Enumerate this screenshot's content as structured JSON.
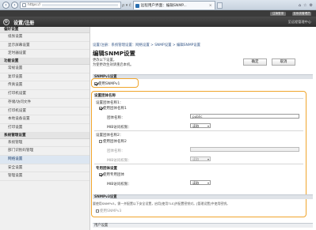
{
  "browser": {
    "url": "https://",
    "address_controls": "ρ ▾ ĉ",
    "tab_title": "远程用户界面：编辑SNMP...",
    "tab_close": "×",
    "win_controls": [
      "⌂",
      "☆",
      "⚙"
    ]
  },
  "header": {
    "top_button": "注销登录",
    "top_link": "至系统管理员",
    "title": "设置/注册",
    "right_link": "至远程管理中心"
  },
  "sidebar": {
    "items": [
      {
        "label": "偏好设置",
        "type": "head"
      },
      {
        "label": "纸张设置",
        "type": "item"
      },
      {
        "label": "显示屏幕设置",
        "type": "item"
      },
      {
        "label": "定时器设置",
        "type": "item"
      },
      {
        "label": "功能设置",
        "type": "head"
      },
      {
        "label": "常规设置",
        "type": "item"
      },
      {
        "label": "复印设置",
        "type": "item"
      },
      {
        "label": "传真设置",
        "type": "item"
      },
      {
        "label": "打印机设置",
        "type": "item"
      },
      {
        "label": "存储/访问文件",
        "type": "item"
      },
      {
        "label": "打印机设置",
        "type": "item"
      },
      {
        "label": "本地设备设置",
        "type": "item"
      },
      {
        "label": "打印设置",
        "type": "item"
      },
      {
        "label": "系统管理设置",
        "type": "head"
      },
      {
        "label": "系统管理",
        "type": "item"
      },
      {
        "label": "部门识别码管理",
        "type": "item"
      },
      {
        "label": "网络设置",
        "type": "item",
        "active": true
      },
      {
        "label": "安全设置",
        "type": "item"
      },
      {
        "label": "管理设置",
        "type": "item"
      }
    ]
  },
  "main": {
    "breadcrumb": "设置/注册：系统管理设置：网络设置 > SNMP设置 > 编辑SNMP设置",
    "title": "编辑SNMP设置",
    "note1": "更改以下设置。",
    "note2": "为使更改生效请重启本机。",
    "ok": "确定",
    "cancel": "取消",
    "snmpv1_header": "SNMPv1设置",
    "use_snmpv1": "使用SNMPv1",
    "community_header": "设置团体名称",
    "c1_title": "设置团体名称1：",
    "c1_use": "使用团体名称1",
    "c1_name_label": "团体名称：",
    "c1_name_value": "public",
    "c1_mib_label": "MIB访问权限：",
    "c1_mib_value": "读取",
    "c2_title": "设置团体名称2：",
    "c2_use": "使用团体名称2",
    "c2_name_label": "团体名称：",
    "c2_name_value": "",
    "c2_mib_label": "MIB访问权限：",
    "c2_mib_value": "读取",
    "dedicated_header": "专用团体设置",
    "dedicated_use": "使用专用团体",
    "dedicated_mib_label": "MIB访问权限：",
    "dedicated_mib_value": "读取",
    "snmpv3_header": "SNMPv3设置",
    "snmpv3_note": "要使用SNMPv3，需一并配置以下安全设置，启用[使用TLS]并配置密钥对。[管理设置]中使用密钥。",
    "use_snmpv3": "使用SNMPv3",
    "snmpv3_sub": "用户设置"
  },
  "colors": {
    "highlight": "#f0a52c",
    "header_bg": "#3b3b3b",
    "active_item": "#dce6f1"
  }
}
